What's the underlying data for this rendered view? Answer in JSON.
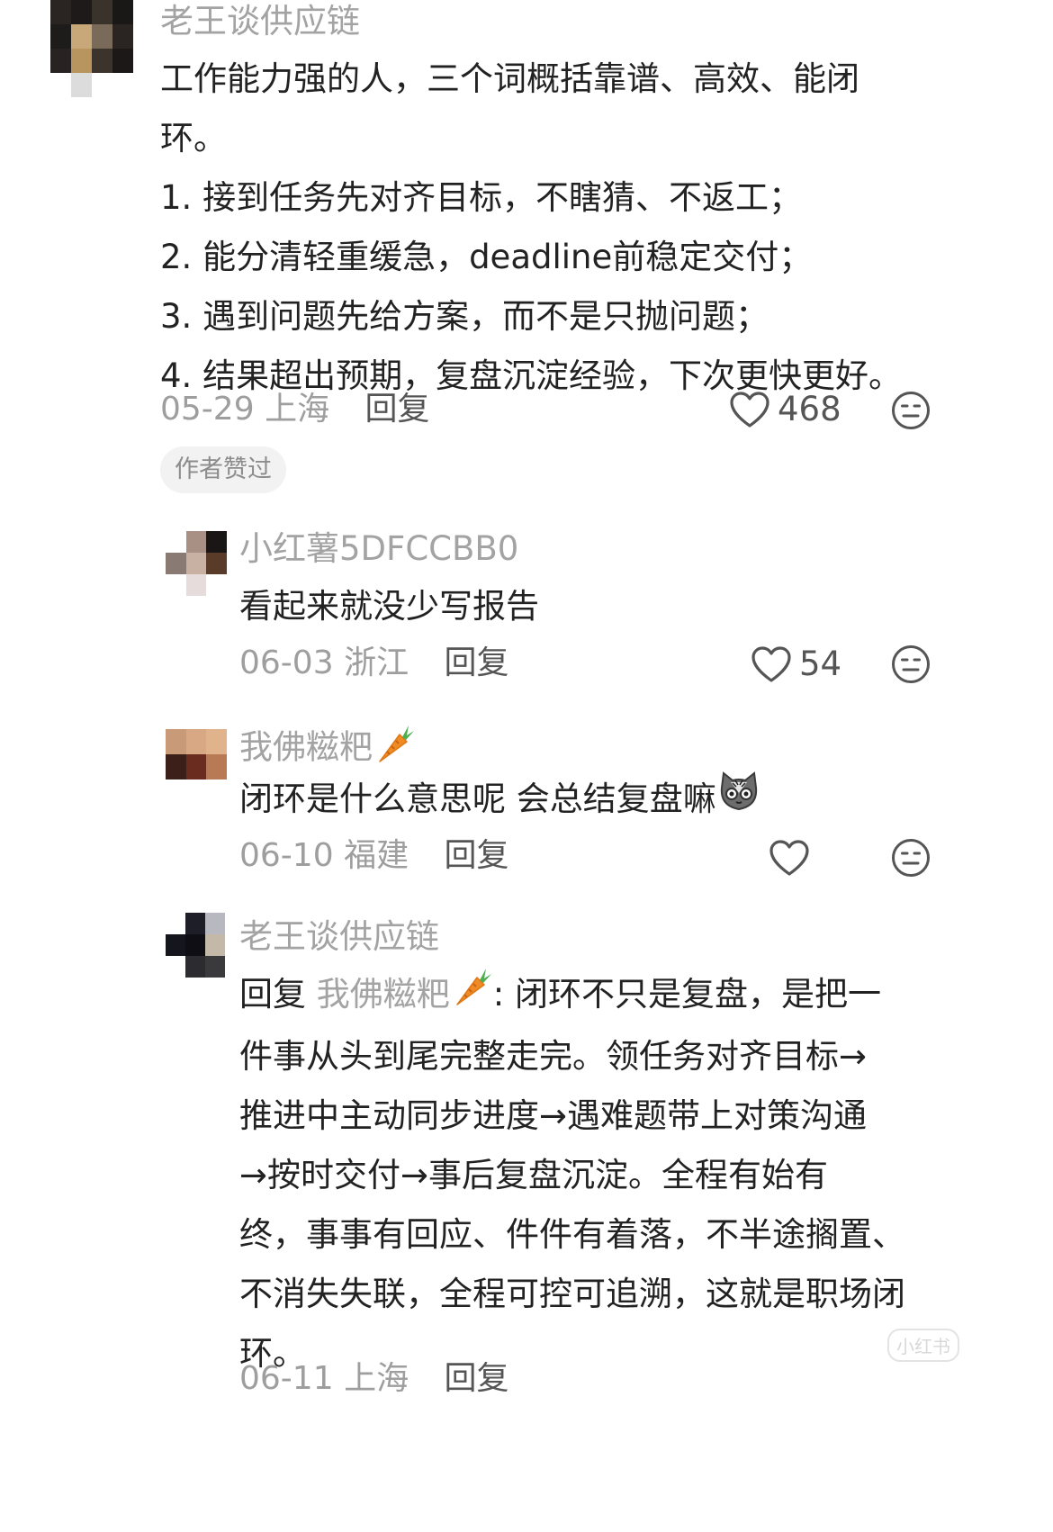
{
  "comments": [
    {
      "author": "老王谈供应链",
      "lines": [
        "工作能力强的人，三个词概括靠谱、高效、能闭",
        "环。",
        "1. 接到任务先对齐目标，不瞎猜、不返工；",
        "2. 能分清轻重缓急，deadline前稳定交付；",
        "3. 遇到问题先给方案，而不是只抛问题；",
        "4. 结果超出预期，复盘沉淀经验，下次更快更好。"
      ],
      "date": "05-29",
      "location": "上海",
      "reply_label": "回复",
      "likes": "468",
      "badge": "作者赞过"
    },
    {
      "author": "小红薯5DFCCBB0",
      "lines": [
        "看起来就没少写报告"
      ],
      "date": "06-03",
      "location": "浙江",
      "reply_label": "回复",
      "likes": "54"
    },
    {
      "author": "我佛糍粑",
      "author_emoji": "carrot",
      "lines": [
        "闭环是什么意思呢 会总结复盘嘛"
      ],
      "trailing_emoji": "cat-face",
      "date": "06-10",
      "location": "福建",
      "reply_label": "回复",
      "likes": ""
    },
    {
      "author": "老王谈供应链",
      "reply_prefix": "回复",
      "reply_to": "我佛糍粑",
      "reply_to_emoji": "carrot",
      "first_line_rest": ": 闭环不只是复盘，是把一",
      "lines": [
        "件事从头到尾完整走完。领任务对齐目标→",
        "推进中主动同步进度→遇难题带上对策沟通",
        "→按时交付→事后复盘沉淀。全程有始有",
        "终，事事有回应、件件有着落，不半途搁置、",
        "不消失失联，全程可控可追溯，这就是职场闭",
        "环。"
      ],
      "date": "06-11",
      "location": "上海",
      "reply_label": "回复"
    }
  ],
  "watermark": "小红书",
  "colors": {
    "text": "#222222",
    "name": "#a3a3a3",
    "meta": "#9e9e9e",
    "icon": "#555555",
    "badge_bg": "#f2f2f2"
  },
  "icons": {
    "like": "heart-outline-icon",
    "dislike": "neutral-face-icon"
  }
}
